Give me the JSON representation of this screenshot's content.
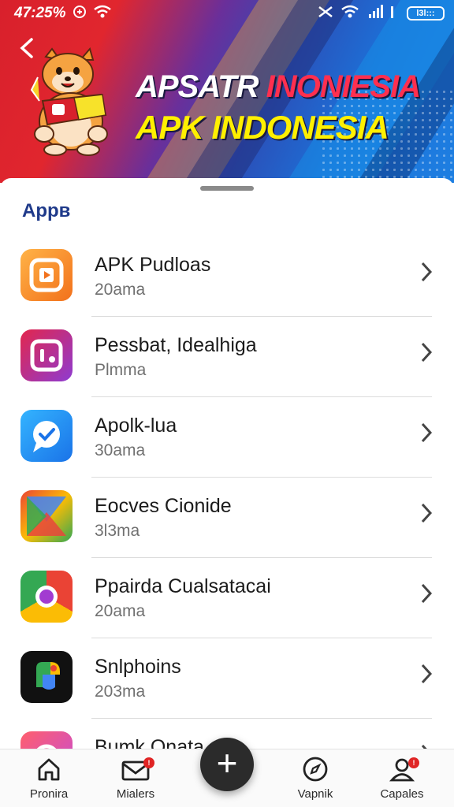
{
  "status_bar": {
    "time": "47:25%",
    "battery_text": "l3l:::"
  },
  "header": {
    "title_line1_a": "APSATR ",
    "title_line1_b": "INONIESIA",
    "title_line2": "APK INDONESIA"
  },
  "section": {
    "title": "Appв"
  },
  "apps": [
    {
      "name": "APK Pudloas",
      "sub": "20ama",
      "icon": "play-square-icon"
    },
    {
      "name": "Pessbat, Idealhiga",
      "sub": "Plmma",
      "icon": "gallery-icon"
    },
    {
      "name": "Apolk-lua",
      "sub": "30ama",
      "icon": "chat-check-icon"
    },
    {
      "name": "Eocves Cionide",
      "sub": "3l3ma",
      "icon": "triangle-store-icon"
    },
    {
      "name": "Ppairda Cualsatacai",
      "sub": "20ama",
      "icon": "chrome-circle-icon"
    },
    {
      "name": "Snlphoins",
      "sub": "203ma",
      "icon": "leaf-icon"
    },
    {
      "name": "Bumk Onata",
      "sub": "",
      "icon": "circle-gradient-icon"
    }
  ],
  "nav": {
    "home": "Pronira",
    "mail": "Mialers",
    "tasks": "Vapnik",
    "profile": "Capales",
    "mail_badge": "!",
    "profile_badge": "!",
    "fab_symbol": "+"
  },
  "colors": {
    "section_title": "#1f3a8a",
    "banner_red": "#e1262e",
    "banner_blue": "#1d7fe2",
    "title_yellow": "#fff000",
    "badge_red": "#e02424"
  }
}
